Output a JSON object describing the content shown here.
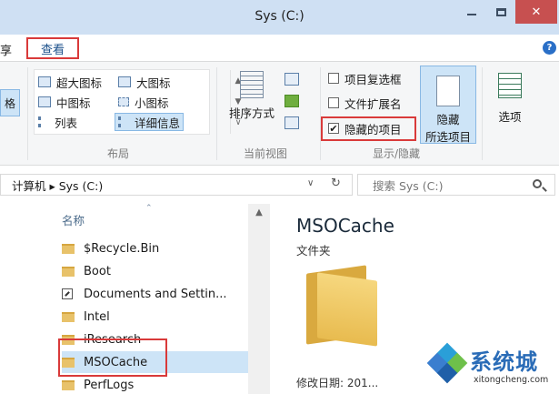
{
  "window": {
    "title": "Sys (C:)"
  },
  "menu": {
    "share_fragment": "享",
    "view_tab": "查看",
    "help": "?"
  },
  "ribbon": {
    "pane_fragment": "格",
    "layout": {
      "items": [
        {
          "label": "超大图标",
          "icon": "extra-large-icons-icon"
        },
        {
          "label": "大图标",
          "icon": "large-icons-icon"
        },
        {
          "label": "中图标",
          "icon": "medium-icons-icon"
        },
        {
          "label": "小图标",
          "icon": "small-icons-icon"
        },
        {
          "label": "列表",
          "icon": "list-icon"
        },
        {
          "label": "详细信息",
          "icon": "details-icon",
          "selected": true
        }
      ],
      "group_label": "布局"
    },
    "current_view": {
      "sort_label": "排序方式",
      "group_label": "当前视图"
    },
    "show_hide": {
      "item_checkboxes": {
        "label": "项目复选框",
        "checked": false
      },
      "file_extensions": {
        "label": "文件扩展名",
        "checked": false
      },
      "hidden_items": {
        "label": "隐藏的项目",
        "checked": true
      },
      "hide_selected_line1": "隐藏",
      "hide_selected_line2": "所选项目",
      "group_label": "显示/隐藏"
    },
    "options_label": "选项"
  },
  "address": {
    "path": "计算机 ▸ Sys (C:)",
    "dropdown": "∨",
    "refresh": "↻",
    "search_placeholder": "搜索 Sys (C:)"
  },
  "file_list": {
    "column_name": "名称",
    "items": [
      {
        "name": "$Recycle.Bin",
        "type": "folder"
      },
      {
        "name": "Boot",
        "type": "folder"
      },
      {
        "name": "Documents and Settin...",
        "type": "shortcut"
      },
      {
        "name": "Intel",
        "type": "folder"
      },
      {
        "name": "iResearch",
        "type": "folder"
      },
      {
        "name": "MSOCache",
        "type": "folder",
        "selected": true
      },
      {
        "name": "PerfLogs",
        "type": "folder"
      }
    ]
  },
  "preview": {
    "name": "MSOCache",
    "kind": "文件夹",
    "modified_label": "修改日期:",
    "modified_value": "201..."
  },
  "watermark": {
    "brand": "系统城",
    "site": "xitongcheng.com"
  },
  "colors": {
    "highlight_frame": "#d93a3a",
    "selection": "#cde4f7",
    "accent": "#2a6fc7",
    "titlebar": "#cfe0f3"
  }
}
